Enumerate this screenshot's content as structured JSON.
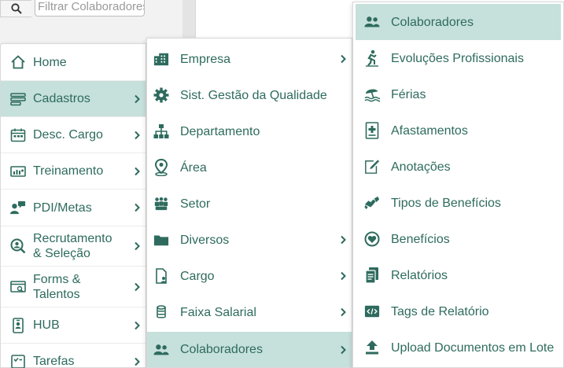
{
  "search": {
    "placeholder": "Filtrar Colaboradores"
  },
  "colors": {
    "accent": "#2e6b5e",
    "active_bg": "#c6e0dc"
  },
  "main_menu": [
    {
      "label": "Home",
      "icon": "home-icon",
      "has_submenu": false
    },
    {
      "label": "Cadastros",
      "icon": "list-icon",
      "has_submenu": true,
      "active": true
    },
    {
      "label": "Desc. Cargo",
      "icon": "calendar-icon",
      "has_submenu": true
    },
    {
      "label": "Treinamento",
      "icon": "presentation-icon",
      "has_submenu": true
    },
    {
      "label": "PDI/Metas",
      "icon": "user-chat-icon",
      "has_submenu": true
    },
    {
      "label": "Recrutamento & Seleção",
      "icon": "search-user-icon",
      "has_submenu": true
    },
    {
      "label": "Forms & Talentos",
      "icon": "form-search-icon",
      "has_submenu": true
    },
    {
      "label": "HUB",
      "icon": "id-badge-icon",
      "has_submenu": true
    },
    {
      "label": "Tarefas",
      "icon": "tasks-icon",
      "has_submenu": true
    }
  ],
  "cadastros_menu": [
    {
      "label": "Empresa",
      "icon": "building-icon",
      "has_submenu": true
    },
    {
      "label": "Sist. Gestão da Qualidade",
      "icon": "gear-icon",
      "has_submenu": false
    },
    {
      "label": "Departamento",
      "icon": "org-chart-icon",
      "has_submenu": false
    },
    {
      "label": "Área",
      "icon": "map-pin-icon",
      "has_submenu": false
    },
    {
      "label": "Setor",
      "icon": "group-icon",
      "has_submenu": false
    },
    {
      "label": "Diversos",
      "icon": "folder-icon",
      "has_submenu": true
    },
    {
      "label": "Cargo",
      "icon": "document-user-icon",
      "has_submenu": true
    },
    {
      "label": "Faixa Salarial",
      "icon": "coins-icon",
      "has_submenu": true
    },
    {
      "label": "Colaboradores",
      "icon": "users-icon",
      "has_submenu": true,
      "active": true
    }
  ],
  "colaboradores_menu": [
    {
      "label": "Colaboradores",
      "icon": "users-icon",
      "active": true
    },
    {
      "label": "Evoluções Profissionais",
      "icon": "running-person-icon"
    },
    {
      "label": "Férias",
      "icon": "beach-umbrella-icon"
    },
    {
      "label": "Afastamentos",
      "icon": "medical-file-icon"
    },
    {
      "label": "Anotações",
      "icon": "edit-note-icon"
    },
    {
      "label": "Tipos de Benefícios",
      "icon": "handshake-icon"
    },
    {
      "label": "Benefícios",
      "icon": "heart-circle-icon"
    },
    {
      "label": "Relatórios",
      "icon": "report-icon"
    },
    {
      "label": "Tags de Relatório",
      "icon": "code-tag-icon"
    },
    {
      "label": "Upload Documentos em Lote",
      "icon": "upload-icon"
    }
  ]
}
